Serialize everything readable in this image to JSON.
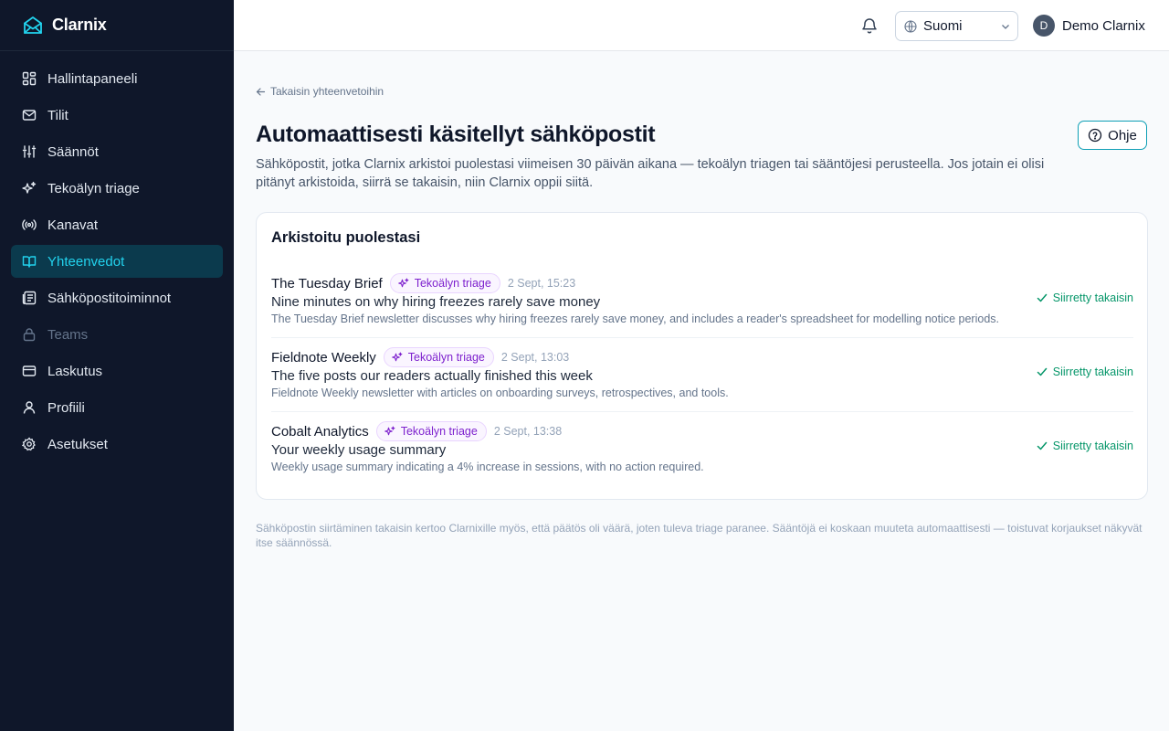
{
  "brand": {
    "name": "Clarnix",
    "logo_icon": "envelope-logo-icon",
    "accent": "#22d3ee"
  },
  "sidebar": {
    "items": [
      {
        "label": "Hallintapaneeli",
        "icon": "dashboard-icon"
      },
      {
        "label": "Tilit",
        "icon": "mail-icon"
      },
      {
        "label": "Säännöt",
        "icon": "sliders-icon"
      },
      {
        "label": "Tekoälyn triage",
        "icon": "sparkles-icon"
      },
      {
        "label": "Kanavat",
        "icon": "broadcast-icon"
      },
      {
        "label": "Yhteenvedot",
        "icon": "book-icon",
        "active": true
      },
      {
        "label": "Sähköpostitoiminnot",
        "icon": "list-icon"
      },
      {
        "label": "Teams",
        "icon": "lock-icon",
        "disabled": true
      },
      {
        "label": "Laskutus",
        "icon": "credit-card-icon"
      },
      {
        "label": "Profiili",
        "icon": "user-icon"
      },
      {
        "label": "Asetukset",
        "icon": "gear-icon"
      }
    ]
  },
  "header": {
    "language": "Suomi",
    "user_initial": "D",
    "user_name": "Demo Clarnix"
  },
  "main": {
    "back_label": "Takaisin yhteenvetoihin",
    "title": "Automaattisesti käsitellyt sähköpostit",
    "description": "Sähköpostit, jotka Clarnix arkistoi puolestasi viimeisen 30 päivän aikana — tekoälyn triagen tai sääntöjesi perusteella. Jos jotain ei olisi pitänyt arkistoida, siirrä se takaisin, niin Clarnix oppii siitä.",
    "help_label": "Ohje",
    "card_title": "Arkistoitu puolestasi",
    "emails": [
      {
        "sender": "The Tuesday Brief",
        "badge": "Tekoälyn triage",
        "time": "2 Sept, 15:23",
        "subject": "Nine minutes on why hiring freezes rarely save money",
        "summary": "The Tuesday Brief newsletter discusses why hiring freezes rarely save money, and includes a reader's spreadsheet for modelling notice periods.",
        "status": "Siirretty takaisin"
      },
      {
        "sender": "Fieldnote Weekly",
        "badge": "Tekoälyn triage",
        "time": "2 Sept, 13:03",
        "subject": "The five posts our readers actually finished this week",
        "summary": "Fieldnote Weekly newsletter with articles on onboarding surveys, retrospectives, and tools.",
        "status": "Siirretty takaisin"
      },
      {
        "sender": "Cobalt Analytics",
        "badge": "Tekoälyn triage",
        "time": "2 Sept, 13:38",
        "subject": "Your weekly usage summary",
        "summary": "Weekly usage summary indicating a 4% increase in sessions, with no action required.",
        "status": "Siirretty takaisin"
      }
    ],
    "footnote": "Sähköpostin siirtäminen takaisin kertoo Clarnixille myös, että päätös oli väärä, joten tuleva triage paranee. Sääntöjä ei koskaan muuteta automaattisesti — toistuvat korjaukset näkyvät itse säännössä."
  }
}
